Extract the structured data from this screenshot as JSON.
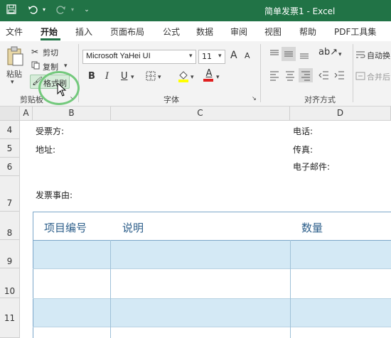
{
  "titlebar": {
    "title": "简单发票1  -  Excel",
    "save_icon": "save-icon",
    "undo_icon": "undo-icon",
    "redo_icon": "redo-icon",
    "customize_icon": "customize-qat-icon"
  },
  "tabs": [
    "文件",
    "开始",
    "插入",
    "页面布局",
    "公式",
    "数据",
    "审阅",
    "视图",
    "帮助",
    "PDF工具集"
  ],
  "ribbon": {
    "clipboard": {
      "paste_label": "粘贴",
      "cut_label": "剪切",
      "copy_label": "复制",
      "format_painter_label": "格式刷",
      "group_label": "剪贴板"
    },
    "font": {
      "font_name": "Microsoft YaHei UI",
      "font_size": "11",
      "grow_label": "A",
      "shrink_label": "A",
      "bold_label": "B",
      "italic_label": "I",
      "underline_label": "U",
      "color_label": "A",
      "group_label": "字体"
    },
    "alignment": {
      "wrap_label": "自动换",
      "merge_label": "合并后",
      "group_label": "对齐方式"
    }
  },
  "columns": [
    "A",
    "B",
    "C",
    "D"
  ],
  "rows": [
    "4",
    "5",
    "6",
    "7",
    "8",
    "9",
    "10",
    "11"
  ],
  "cells": {
    "buyer_label": "受票方:",
    "address_label": "地址:",
    "phone_label": "电话:",
    "fax_label": "传真:",
    "email_label": "电子邮件:",
    "reason_label": "发票事由:"
  },
  "table_headers": [
    "项目编号",
    "说明",
    "数量"
  ],
  "colors": {
    "excel_green": "#217346",
    "band_blue": "#d4e9f5",
    "header_text": "#2c5e8a",
    "highlight_ring": "#73c97c"
  }
}
